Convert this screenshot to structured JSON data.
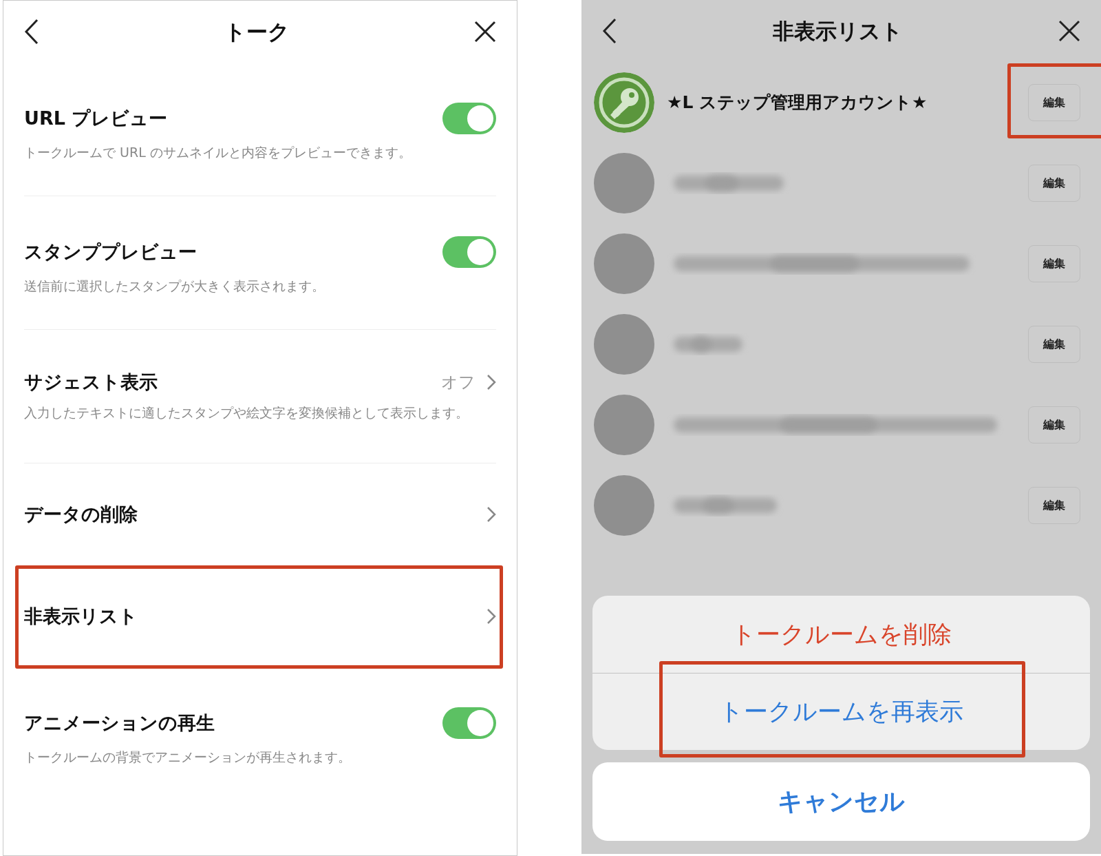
{
  "settings_screen": {
    "title": "トーク",
    "items": [
      {
        "kind": "toggle",
        "title": "URL プレビュー",
        "description": "トークルームで URL のサムネイルと内容をプレビューできます。",
        "on": true,
        "highlighted": false
      },
      {
        "kind": "toggle",
        "title": "スタンププレビュー",
        "description": "送信前に選択したスタンプが大きく表示されます。",
        "on": true,
        "highlighted": false
      },
      {
        "kind": "value",
        "title": "サジェスト表示",
        "value": "オフ",
        "description": "入力したテキストに適したスタンプや絵文字を変換候補として表示します。",
        "highlighted": false
      },
      {
        "kind": "link",
        "title": "データの削除",
        "highlighted": false
      },
      {
        "kind": "link",
        "title": "非表示リスト",
        "highlighted": true
      },
      {
        "kind": "toggle",
        "title": "アニメーションの再生",
        "description": "トークルームの背景でアニメーションが再生されます。",
        "on": true,
        "highlighted": false
      }
    ]
  },
  "hidden_list_screen": {
    "title": "非表示リスト",
    "rows": [
      {
        "kind": "named",
        "name": "★L ステップ管理用アカウント★",
        "edit_label": "編集",
        "highlighted": true
      },
      {
        "kind": "blurred",
        "edit_label": "編集",
        "highlighted": false
      },
      {
        "kind": "blurred",
        "edit_label": "編集",
        "highlighted": false
      },
      {
        "kind": "blurred",
        "edit_label": "編集",
        "highlighted": false
      },
      {
        "kind": "blurred",
        "edit_label": "編集",
        "highlighted": false
      },
      {
        "kind": "blurred",
        "edit_label": "編集",
        "highlighted": false
      }
    ],
    "action_sheet": {
      "options": [
        {
          "kind": "destructive",
          "label": "トークルームを削除",
          "highlighted": false
        },
        {
          "kind": "default",
          "label": "トークルームを再表示",
          "highlighted": true
        }
      ],
      "cancel": "キャンセル"
    }
  }
}
